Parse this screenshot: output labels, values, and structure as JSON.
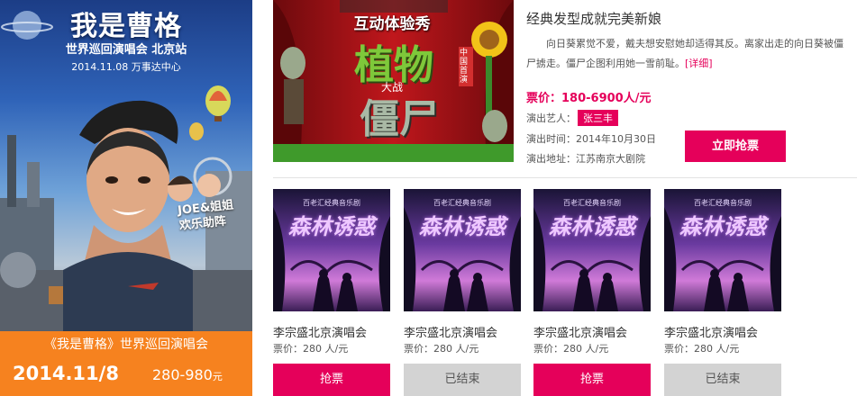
{
  "colors": {
    "accent": "#e5005a",
    "poster_bar": "#f6821f",
    "ended_button": "#d3d3d3"
  },
  "poster": {
    "title": "我是曹格",
    "subtitle": "世界巡回演唱会 北京站",
    "date_venue": "2014.11.08 万事达中心",
    "guest_line1": "JOE&姐姐",
    "guest_line2": "欢乐助阵",
    "caption": "《我是曹格》世界巡回演唱会",
    "date": "2014.11/8",
    "price": "280-980",
    "price_unit": "元"
  },
  "featured": {
    "image_title_top": "互动体验秀",
    "image_title_main1": "植物",
    "image_title_mid": "大战",
    "image_title_main2": "僵尸",
    "image_badge": "中国首演",
    "title": "经典发型成就完美新娘",
    "description": "向日葵累觉不爱，戴夫想安慰她却适得其反。离家出走的向日葵被僵尸掳走。僵尸企图利用她一雪前耻。",
    "more_link": "[详细]",
    "price": "票价：180-6900人/元",
    "artist_label": "演出艺人：",
    "artist": "张三丰",
    "time_label": "演出时间：",
    "time": "2014年10月30日",
    "venue_label": "演出地址：",
    "venue": "江苏南京大剧院",
    "buy_button": "立即抢票"
  },
  "cards": [
    {
      "img_top": "百老汇经典音乐剧",
      "img_title": "森林诱惑",
      "title": "李宗盛北京演唱会",
      "price": "票价：280 人/元",
      "button": "抢票",
      "status": "buy"
    },
    {
      "img_top": "百老汇经典音乐剧",
      "img_title": "森林诱惑",
      "title": "李宗盛北京演唱会",
      "price": "票价：280 人/元",
      "button": "已结束",
      "status": "ended"
    },
    {
      "img_top": "百老汇经典音乐剧",
      "img_title": "森林诱惑",
      "title": "李宗盛北京演唱会",
      "price": "票价：280 人/元",
      "button": "抢票",
      "status": "buy"
    },
    {
      "img_top": "百老汇经典音乐剧",
      "img_title": "森林诱惑",
      "title": "李宗盛北京演唱会",
      "price": "票价：280 人/元",
      "button": "已结束",
      "status": "ended"
    }
  ]
}
